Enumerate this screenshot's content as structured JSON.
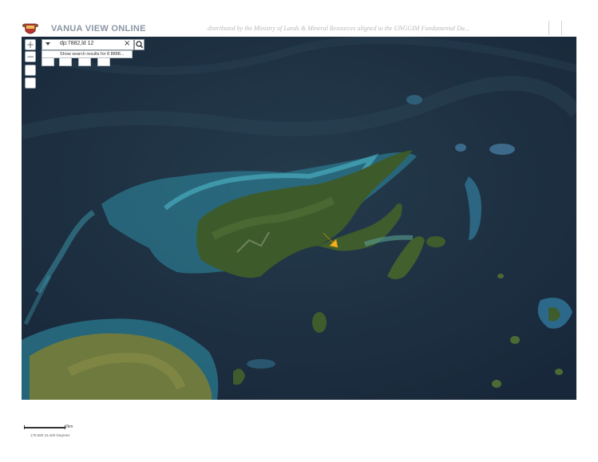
{
  "header": {
    "app_title": "VANUA VIEW ONLINE",
    "subtitle": "distributed by the Ministry of Lands & Mineral Resources aligned to the UNGGIM Fundamental Da..."
  },
  "map_controls": {
    "zoom_in_label": "+",
    "zoom_out_label": "−"
  },
  "search": {
    "value": "dp:7882,ld 12",
    "clear_label": "×",
    "results_text": "Show search results for 8 8888..."
  },
  "footer": {
    "scale_label": "2km",
    "coordinates": "178.680  16.400 Degrees"
  },
  "colors": {
    "ocean_deep": "#1f3140",
    "ocean_shallow": "#2f8ea5",
    "land": "#3d5a2b",
    "marker": "#f2b31e"
  },
  "icons": {
    "logo": "coat-of-arms-icon",
    "search": "magnifier-icon",
    "marker": "arrow-marker-icon"
  }
}
